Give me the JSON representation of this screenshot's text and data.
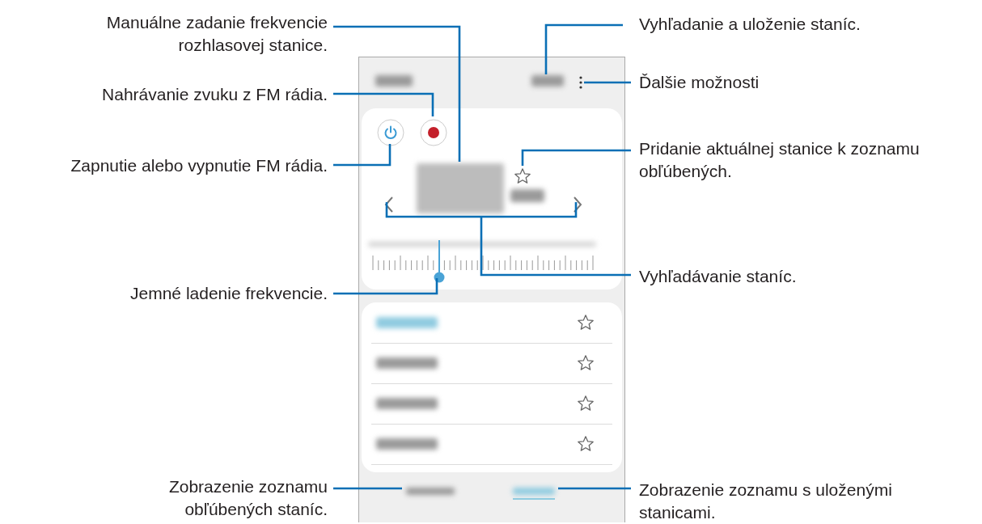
{
  "left_callouts": [
    {
      "text": "Manuálne zadanie frekvencie rozhlasovej stanice."
    },
    {
      "text": "Nahrávanie zvuku z FM rádia."
    },
    {
      "text": "Zapnutie alebo vypnutie FM rádia."
    },
    {
      "text": "Jemné ladenie frekvencie."
    },
    {
      "text": "Zobrazenie zoznamu obľúbených staníc."
    }
  ],
  "right_callouts": [
    {
      "text": "Vyhľadanie a uloženie staníc."
    },
    {
      "text": "Ďalšie možnosti"
    },
    {
      "text": "Pridanie aktuálnej stanice k zoznamu obľúbených."
    },
    {
      "text": "Vyhľadávanie staníc."
    },
    {
      "text": "Zobrazenie zoznamu s uloženými stanicami."
    }
  ],
  "phone": {
    "tuner": {
      "level": 0.3
    },
    "stations": [
      {
        "selected": true,
        "favorite": false
      },
      {
        "selected": false,
        "favorite": false
      },
      {
        "selected": false,
        "favorite": false
      },
      {
        "selected": false,
        "favorite": false
      }
    ],
    "tabs": [
      {
        "selected": false
      },
      {
        "selected": true
      }
    ]
  }
}
